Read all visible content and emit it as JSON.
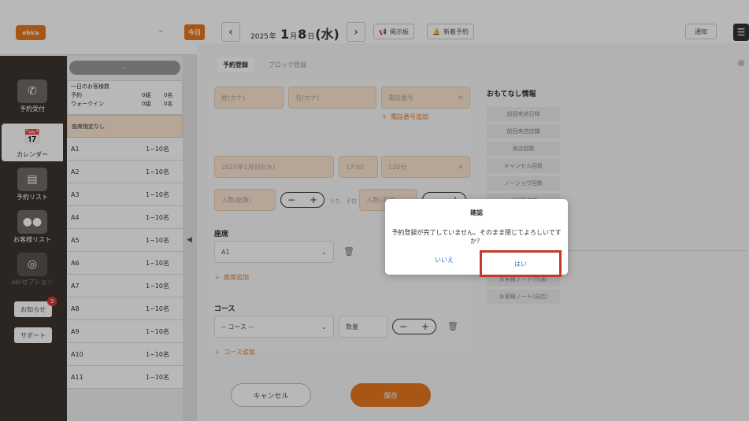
{
  "topbar": {
    "logo": "ebica",
    "today_label": "今日",
    "date": {
      "year": "2025",
      "year_unit": "年",
      "month": "1",
      "month_unit": "月",
      "day": "8",
      "day_unit": "日",
      "weekday": "(水)"
    },
    "board_label": "掲示板",
    "new_reservation_label": "新着予約",
    "notify_label": "通知"
  },
  "leftnav": {
    "items": [
      {
        "label": "予約受付",
        "icon": "phone-icon"
      },
      {
        "label": "カレンダー",
        "icon": "calendar-icon"
      },
      {
        "label": "予約リスト",
        "icon": "list-icon"
      },
      {
        "label": "お客様リスト",
        "icon": "customers-icon"
      },
      {
        "label": "ebiセプション",
        "icon": "reception-icon"
      }
    ],
    "news_label": "お知らせ",
    "news_badge": "3",
    "support_label": "サポート"
  },
  "seats": {
    "header": "-",
    "summary": {
      "title": "一日のお客様数",
      "rows": [
        {
          "label": "予約",
          "groups": "0組",
          "people": "0名"
        },
        {
          "label": "ウォークイン",
          "groups": "0組",
          "people": "0名"
        }
      ]
    },
    "no_seat": "座席指定なし",
    "rows": [
      {
        "name": "A1",
        "capacity": "1~10名"
      },
      {
        "name": "A2",
        "capacity": "1~10名"
      },
      {
        "name": "A3",
        "capacity": "1~10名"
      },
      {
        "name": "A4",
        "capacity": "1~10名"
      },
      {
        "name": "A5",
        "capacity": "1~10名"
      },
      {
        "name": "A6",
        "capacity": "1~10名"
      },
      {
        "name": "A7",
        "capacity": "1~10名"
      },
      {
        "name": "A8",
        "capacity": "1~10名"
      },
      {
        "name": "A9",
        "capacity": "1~10名"
      },
      {
        "name": "A10",
        "capacity": "1~10名"
      },
      {
        "name": "A11",
        "capacity": "1~10名"
      }
    ]
  },
  "panel": {
    "tabs": [
      "予約登録",
      "ブロック登録"
    ],
    "last_name_placeholder": "姓(カナ)",
    "first_name_placeholder": "名(カナ)",
    "phone_placeholder": "電話番号",
    "add_phone": "電話番号追加",
    "date_value": "2025年1月8日(水)",
    "time_value": "17:00",
    "duration_value": "120分",
    "people_placeholder": "人数(総数)",
    "children_prefix": "うち、子供",
    "children_placeholder": "人数(子供)",
    "seat_section": "座席",
    "seat_value": "A1",
    "add_seat": "座席追加",
    "course_section": "コース",
    "course_value": "-- コース --",
    "quantity_placeholder": "数量",
    "add_course": "コース追加",
    "cancel_label": "キャンセル",
    "save_label": "保存"
  },
  "omotenashi": {
    "title": "おもてなし情報",
    "items": [
      "前回来店日時",
      "前回来店店舗",
      "来店回数",
      "キャンセル回数",
      "ノーショウ回数",
      "ご利用金額"
    ],
    "notes": [
      "お客様ノート(共通)",
      "お客様ノート(自店)"
    ]
  },
  "dialog": {
    "title": "確認",
    "message": "予約登録が完了していません。そのまま閉じてよろしいですか？",
    "no_label": "いいえ",
    "yes_label": "はい"
  }
}
